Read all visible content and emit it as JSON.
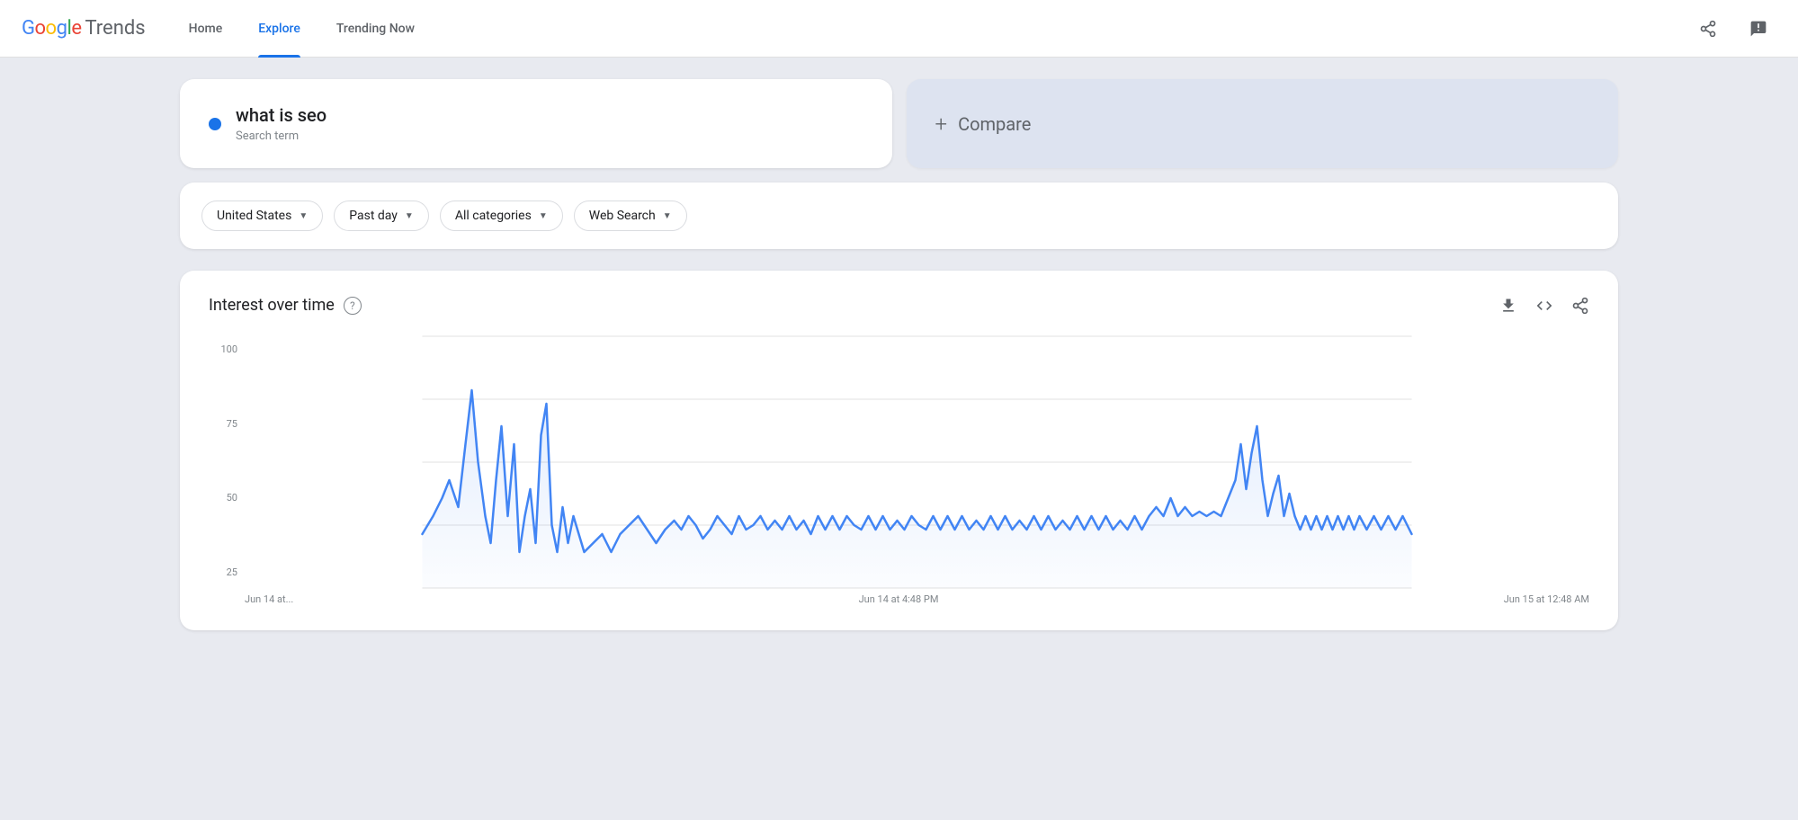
{
  "header": {
    "logo_google": "Google",
    "logo_trends": "Trends",
    "nav": [
      {
        "id": "home",
        "label": "Home",
        "active": false
      },
      {
        "id": "explore",
        "label": "Explore",
        "active": true
      },
      {
        "id": "trending-now",
        "label": "Trending Now",
        "active": false
      }
    ],
    "share_icon": "share",
    "feedback_icon": "feedback"
  },
  "search_card": {
    "dot_color": "#1a73e8",
    "term": "what is seo",
    "type": "Search term"
  },
  "compare_card": {
    "plus": "+",
    "label": "Compare"
  },
  "filters": [
    {
      "id": "region",
      "label": "United States",
      "value": "United States"
    },
    {
      "id": "time",
      "label": "Past day",
      "value": "Past day"
    },
    {
      "id": "category",
      "label": "All categories",
      "value": "All categories"
    },
    {
      "id": "search_type",
      "label": "Web Search",
      "value": "Web Search"
    }
  ],
  "chart": {
    "title": "Interest over time",
    "help_label": "?",
    "download_label": "⬇",
    "embed_label": "<>",
    "share_label": "share",
    "y_labels": [
      "100",
      "75",
      "50",
      "25"
    ],
    "x_labels": [
      "Jun 14 at...",
      "Jun 14 at 4:48 PM",
      "Jun 15 at 12:48 AM"
    ],
    "line_color": "#4285F4",
    "grid_color": "#e0e0e0"
  }
}
